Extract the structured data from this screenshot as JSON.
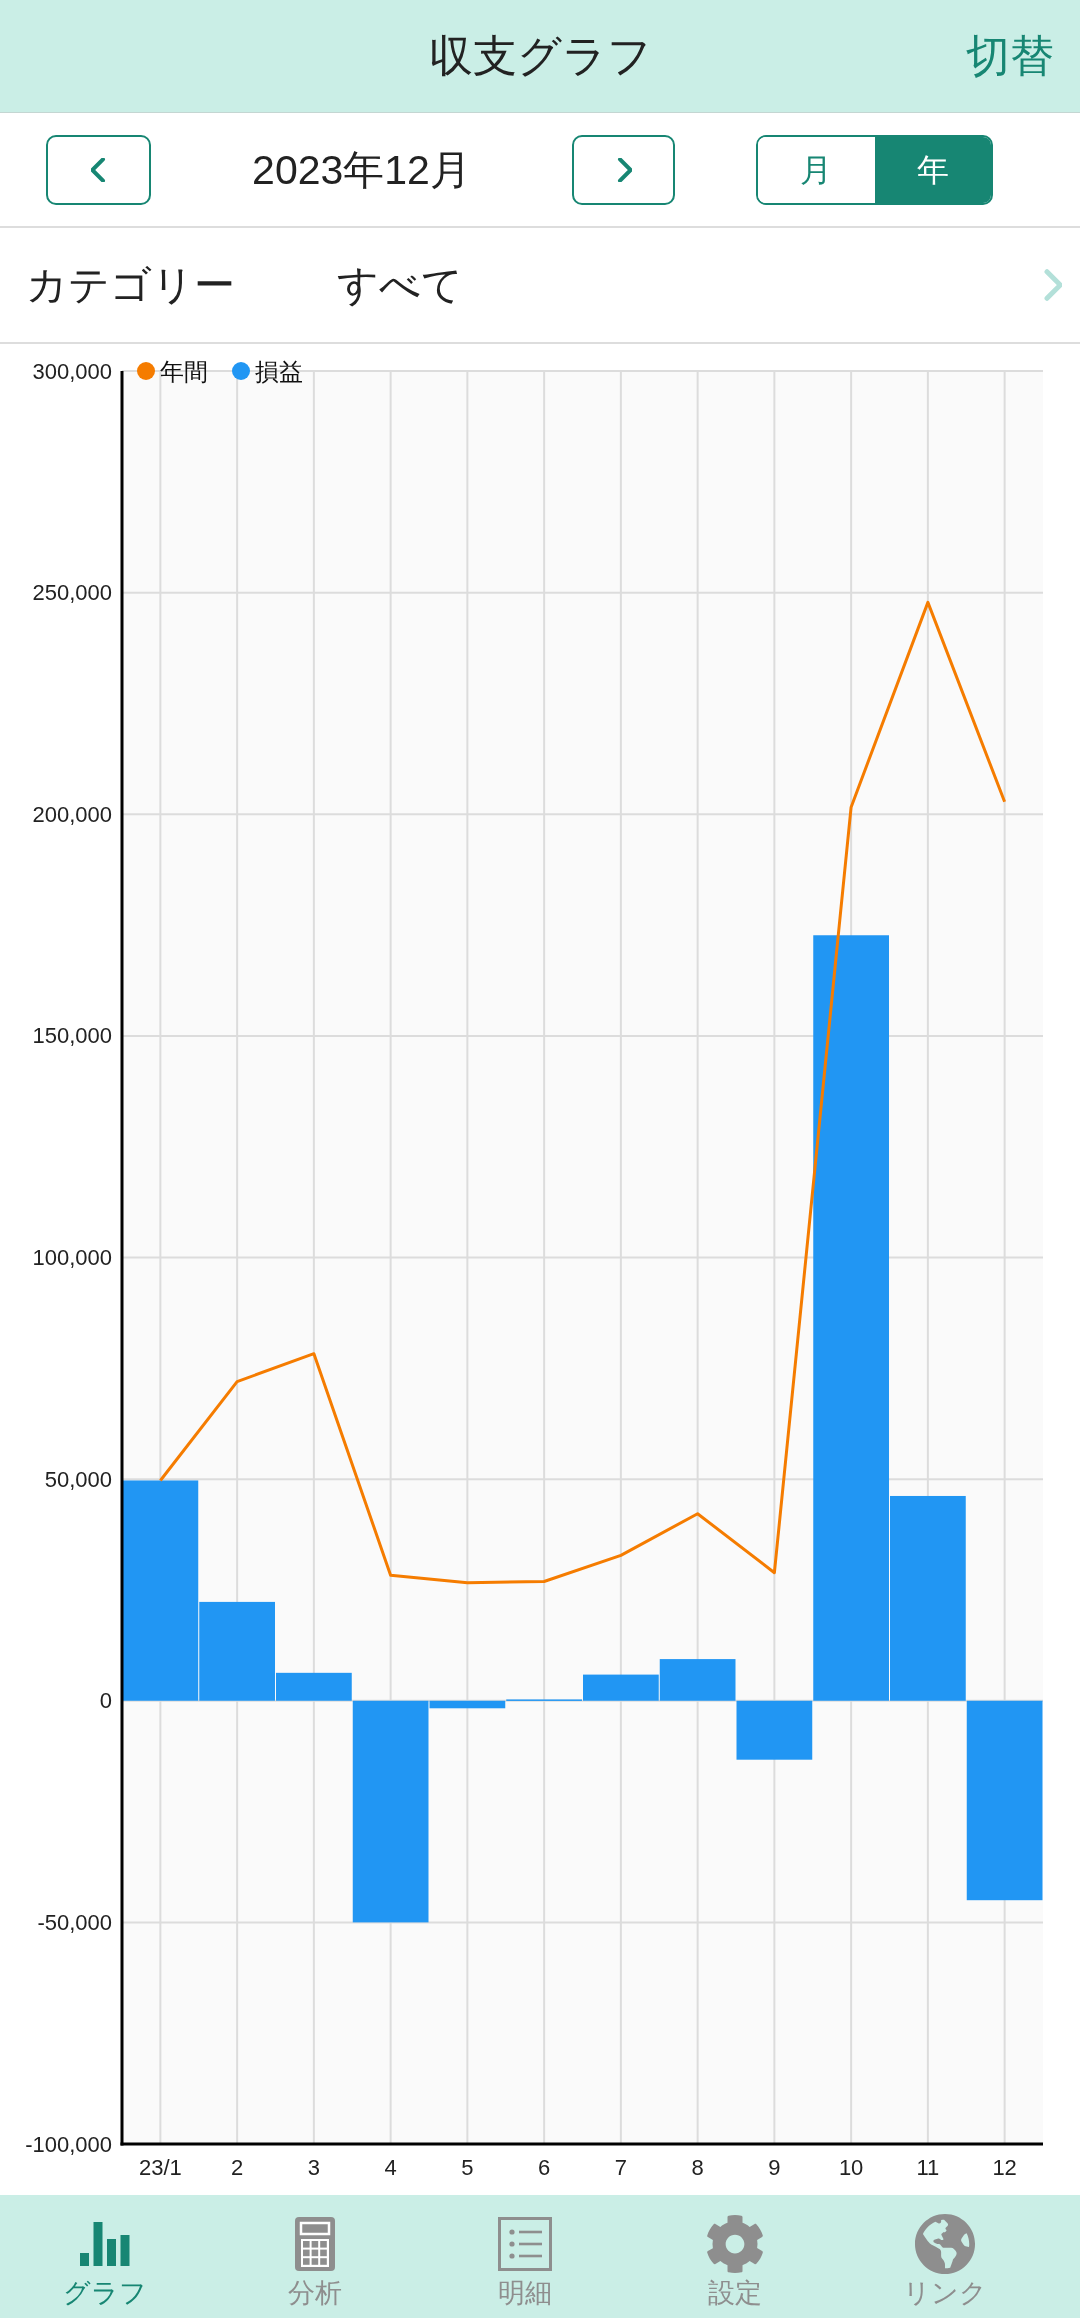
{
  "header": {
    "title": "収支グラフ",
    "switch_label": "切替"
  },
  "period_nav": {
    "date": "2023年12月",
    "toggle": [
      {
        "label": "月",
        "selected": false
      },
      {
        "label": "年",
        "selected": true
      }
    ]
  },
  "category": {
    "label": "カテゴリー",
    "value": "すべて"
  },
  "chart": {
    "chart_data": {
      "type": "bar",
      "categories": [
        "23/1",
        "2",
        "3",
        "4",
        "5",
        "6",
        "7",
        "8",
        "9",
        "10",
        "11",
        "12"
      ],
      "series": [
        {
          "name": "年間",
          "type": "line",
          "color": "#f57c00",
          "values": [
            49700,
            72000,
            78300,
            28300,
            26600,
            26900,
            32800,
            42200,
            28900,
            201600,
            247800,
            202800
          ]
        },
        {
          "name": "損益",
          "color": "#2196f3",
          "values": [
            49700,
            22300,
            6300,
            -50000,
            -1700,
            300,
            5900,
            9400,
            -13300,
            172700,
            46200,
            -45000
          ]
        }
      ],
      "ylim": [
        -100000,
        300000
      ],
      "yticks": [
        {
          "value": 300000,
          "label": "300,000"
        },
        {
          "value": 250000,
          "label": "250,000"
        },
        {
          "value": 200000,
          "label": "200,000"
        },
        {
          "value": 150000,
          "label": "150,000"
        },
        {
          "value": 100000,
          "label": "100,000"
        },
        {
          "value": 50000,
          "label": "50,000"
        },
        {
          "value": 0,
          "label": "0"
        },
        {
          "value": -50000,
          "label": "-50,000"
        },
        {
          "value": -100000,
          "label": "-100,000"
        }
      ],
      "grid": true,
      "legend": "upper left"
    }
  },
  "tab_bar": [
    {
      "label": "グラフ",
      "selected": true
    },
    {
      "label": "分析",
      "selected": false
    },
    {
      "label": "明細",
      "selected": false
    },
    {
      "label": "設定",
      "selected": false
    },
    {
      "label": "リンク",
      "selected": false
    }
  ]
}
